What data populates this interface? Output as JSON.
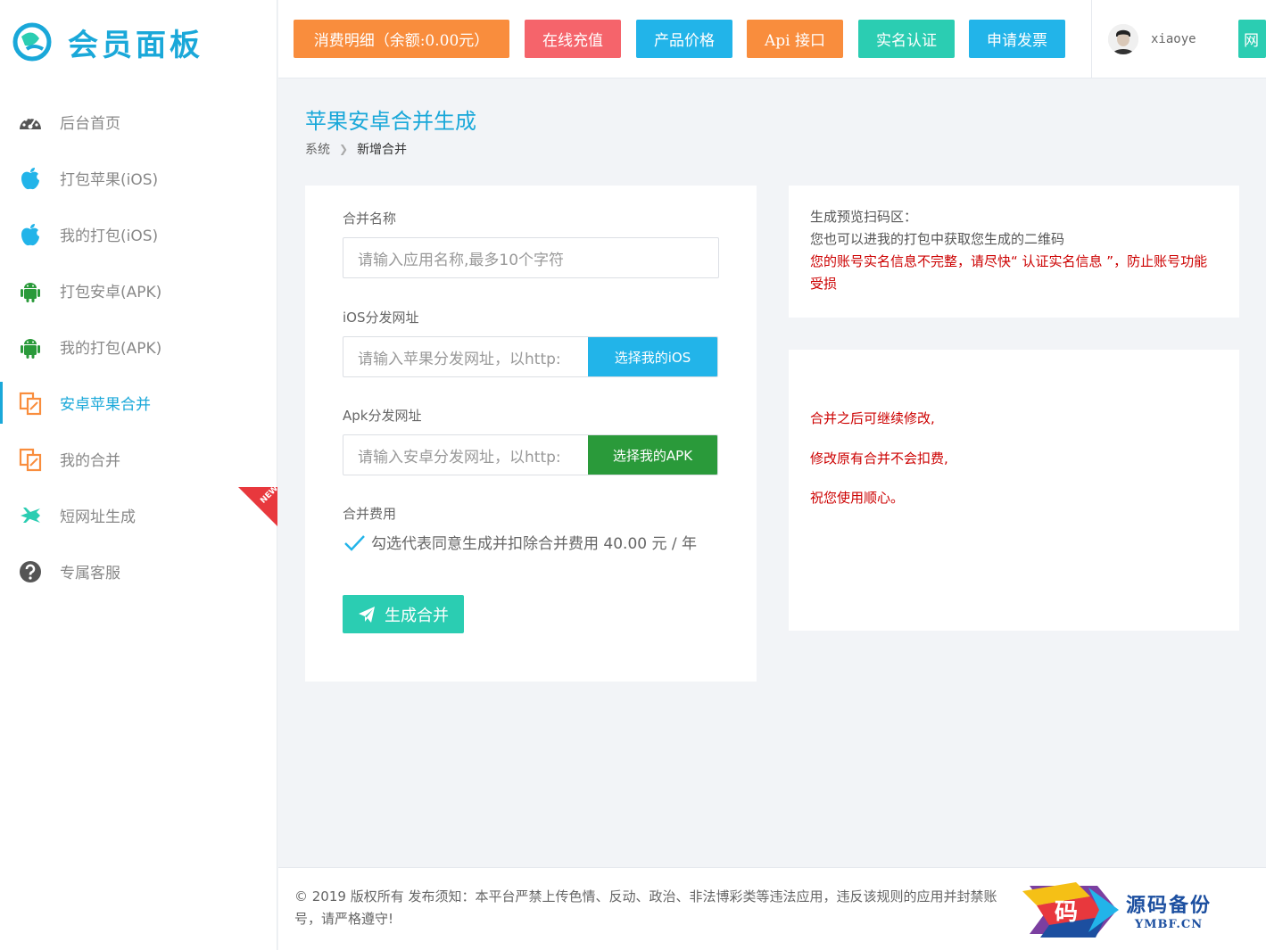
{
  "sidebar": {
    "logo_text": "会员面板",
    "items": [
      {
        "label": "后台首页",
        "icon": "dashboard-icon"
      },
      {
        "label": "打包苹果(iOS)",
        "icon": "apple-icon"
      },
      {
        "label": "我的打包(iOS)",
        "icon": "apple-icon"
      },
      {
        "label": "打包安卓(APK)",
        "icon": "android-icon"
      },
      {
        "label": "我的打包(APK)",
        "icon": "android-icon"
      },
      {
        "label": "安卓苹果合并",
        "icon": "copy-icon",
        "active": true
      },
      {
        "label": "我的合并",
        "icon": "copy-icon"
      },
      {
        "label": "短网址生成",
        "icon": "plane-icon",
        "badge": "NEW"
      },
      {
        "label": "专属客服",
        "icon": "help-icon"
      }
    ]
  },
  "topbar": {
    "buttons": [
      {
        "label": "消费明细（余额:0.00元）",
        "color": "#f98d3d"
      },
      {
        "label": "在线充值",
        "color": "#f5646b"
      },
      {
        "label": "产品价格",
        "color": "#22b4e9"
      },
      {
        "label": "Api 接口",
        "color": "#f98d3d"
      },
      {
        "label": "实名认证",
        "color": "#2bcdb2"
      },
      {
        "label": "申请发票",
        "color": "#22b4e9"
      },
      {
        "label": "网",
        "color": "#2bcdb2"
      }
    ],
    "username": "xiaoye"
  },
  "page": {
    "title": "苹果安卓合并生成",
    "breadcrumb": [
      "系统",
      "新增合并"
    ]
  },
  "form": {
    "name_label": "合并名称",
    "name_placeholder": "请输入应用名称,最多10个字符",
    "ios_label": "iOS分发网址",
    "ios_placeholder": "请输入苹果分发网址，以http:",
    "ios_button": "选择我的iOS",
    "apk_label": "Apk分发网址",
    "apk_placeholder": "请输入安卓分发网址，以http:",
    "apk_button": "选择我的APK",
    "fee_label": "合并费用",
    "fee_text": "勾选代表同意生成并扣除合并费用 40.00 元 / 年",
    "submit": "生成合并"
  },
  "info": {
    "line1": "生成预览扫码区：",
    "line2": "您也可以进我的打包中获取您生成的二维码",
    "warning": "您的账号实名信息不完整，请尽快“ 认证实名信息 ”，防止账号功能受损"
  },
  "notes": [
    "合并之后可继续修改,",
    "修改原有合并不会扣费,",
    "祝您使用顺心。"
  ],
  "footer": {
    "text": "© 2019 版权所有 发布须知：本平台严禁上传色情、反动、政治、非法博彩类等违法应用，违反该规则的应用并封禁账号，请严格遵守!",
    "brand_logo": "码",
    "brand_cn": "源码备份",
    "brand_en": "YMBF.CN"
  },
  "colors": {
    "accent": "#1aa8d9",
    "green": "#2bcdb2",
    "apple_blue": "#22b4e9",
    "android_green": "#2a9a3a",
    "warning": "#cc0000"
  }
}
